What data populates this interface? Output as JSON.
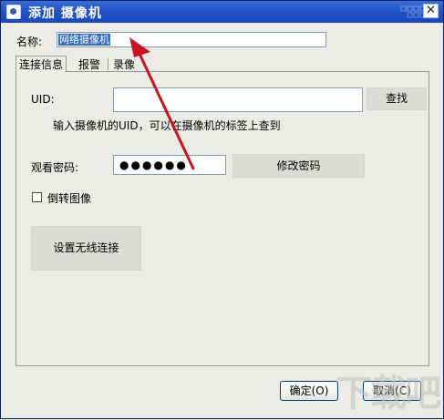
{
  "window": {
    "title": "添加 摄像机",
    "close_symbol": "✕"
  },
  "name_field": {
    "label": "名称:",
    "value": "网络摄像机"
  },
  "tabs": [
    {
      "label": "连接信息",
      "active": true
    },
    {
      "label": "报警",
      "active": false
    },
    {
      "label": "录像",
      "active": false
    }
  ],
  "connection": {
    "uid_label": "UID:",
    "uid_value": "",
    "find_button": "查找",
    "uid_hint": "输入摄像机的UID，可以在摄像机的标签上查到",
    "password_label": "观看密码:",
    "password_mask": "●●●●●●",
    "change_password_button": "修改密码",
    "flip_image_label": "倒转图像",
    "flip_image_checked": false,
    "wireless_button": "设置无线连接"
  },
  "footer": {
    "ok_button": "确定(O)",
    "cancel_button": "取消(C)"
  },
  "watermark": "下载吧",
  "colors": {
    "titlebar": "#1f53c7",
    "selection": "#316ac5",
    "annotation_arrow": "#c8141e"
  }
}
